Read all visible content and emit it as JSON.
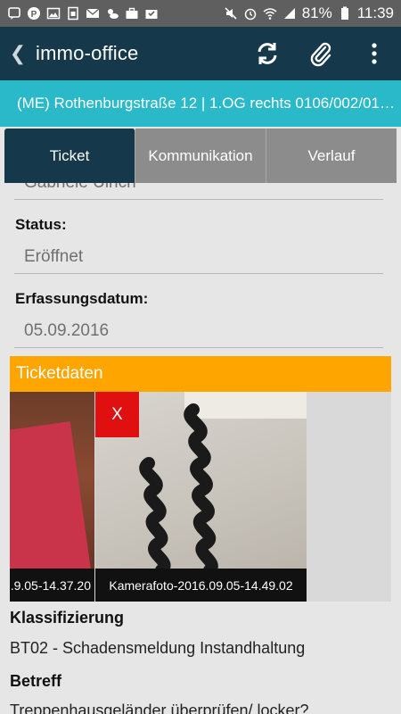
{
  "statusbar": {
    "battery": "81%",
    "time": "11:39"
  },
  "appbar": {
    "title": "immo-office"
  },
  "address": "(ME) Rothenburgstraße 12 | 1.OG rechts 0106/002/01…",
  "tabs": [
    {
      "label": "Ticket",
      "active": true
    },
    {
      "label": "Kommunikation",
      "active": false
    },
    {
      "label": "Verlauf",
      "active": false
    }
  ],
  "form": {
    "clipped_value": "Gabriele Ulrich",
    "status_label": "Status:",
    "status_value": "Eröffnet",
    "date_label": "Erfassungsdatum:",
    "date_value": "05.09.2016"
  },
  "ticketdaten": {
    "header": "Ticketdaten",
    "photos": [
      {
        "caption": ".9.05-14.37.20"
      },
      {
        "caption": "Kamerafoto-2016.09.05-14.49.02"
      }
    ],
    "delete_label": "X"
  },
  "klassifizierung": {
    "label": "Klassifizierung",
    "value": "BT02 - Schadensmeldung Instandhaltung"
  },
  "betreff": {
    "label": "Betreff",
    "value": "Treppenhausgeländer überprüfen/ locker?"
  }
}
